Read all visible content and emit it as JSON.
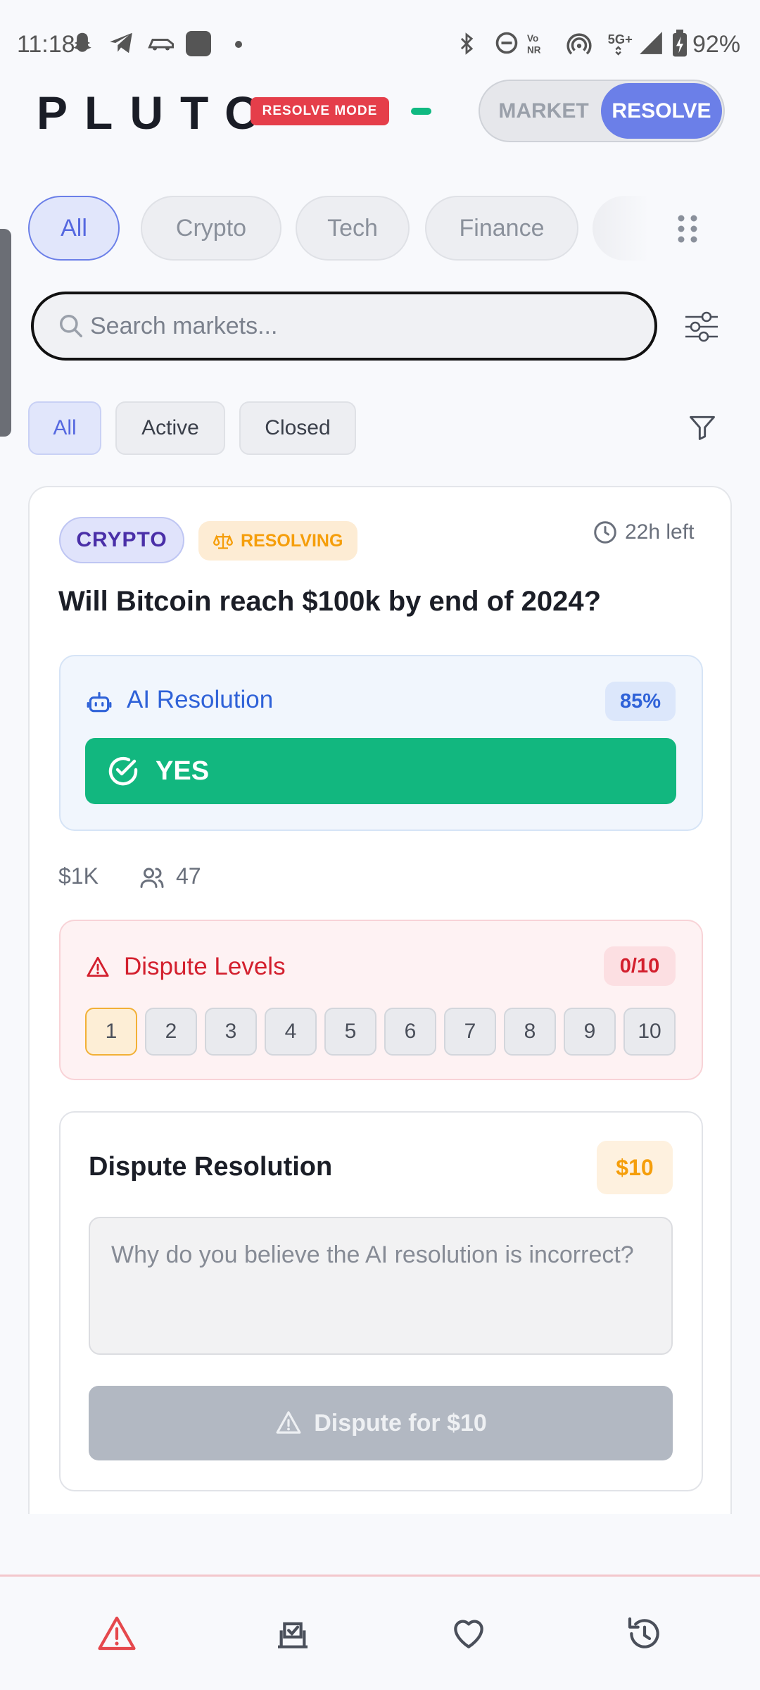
{
  "status_bar": {
    "time": "11:18",
    "battery": "92%",
    "icons": [
      "snapchat-icon",
      "telegram-icon",
      "car-icon",
      "app-icon",
      "dot-icon",
      "bluetooth-icon",
      "dnd-icon",
      "vonr-icon",
      "hotspot-icon",
      "5g-icon",
      "signal-icon",
      "battery-icon"
    ]
  },
  "header": {
    "logo": "PLUTO",
    "mode_badge": "RESOLVE MODE",
    "toggle": {
      "market": "MARKET",
      "resolve": "RESOLVE",
      "selected": "RESOLVE"
    }
  },
  "categories": {
    "items": [
      "All",
      "Crypto",
      "Tech",
      "Finance"
    ],
    "selected": "All"
  },
  "search": {
    "placeholder": "Search markets..."
  },
  "status_filters": {
    "items": [
      "All",
      "Active",
      "Closed"
    ],
    "selected": "All"
  },
  "market": {
    "category": "CRYPTO",
    "status": "RESOLVING",
    "time_left": "22h left",
    "question": "Will Bitcoin reach $100k by end of 2024?",
    "ai_resolution": {
      "label": "AI Resolution",
      "confidence": "85%",
      "outcome": "YES"
    },
    "volume": "$1K",
    "participants": "47",
    "dispute_levels": {
      "label": "Dispute Levels",
      "count": "0/10",
      "levels": [
        "1",
        "2",
        "3",
        "4",
        "5",
        "6",
        "7",
        "8",
        "9",
        "10"
      ],
      "current": "1"
    },
    "dispute_form": {
      "title": "Dispute Resolution",
      "price": "$10",
      "placeholder": "Why do you believe the AI resolution is incorrect?",
      "button": "Dispute for $10"
    }
  },
  "colors": {
    "accent": "#6b7fe8",
    "yes": "#12b77f",
    "danger": "#d3202e",
    "warning": "#f59e0b"
  },
  "bottom_nav": [
    "alert-icon",
    "ballot-box-icon",
    "heart-icon",
    "history-icon"
  ]
}
